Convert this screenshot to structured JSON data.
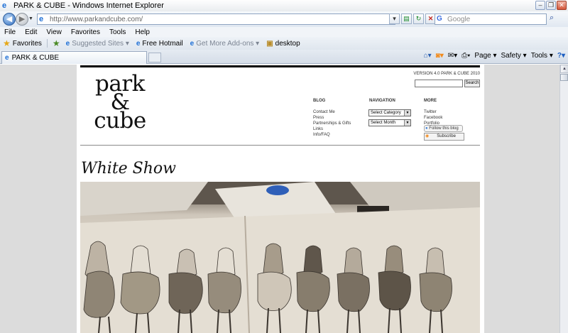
{
  "window": {
    "title": "PARK & CUBE - Windows Internet Explorer"
  },
  "address": {
    "url": "http://www.parkandcube.com/",
    "search_placeholder": "Google"
  },
  "menu": [
    "File",
    "Edit",
    "View",
    "Favorites",
    "Tools",
    "Help"
  ],
  "favorites_bar": {
    "favorites_label": "Favorites",
    "items": [
      {
        "label": "Suggested Sites",
        "muted": true
      },
      {
        "label": "Free Hotmail",
        "muted": false
      },
      {
        "label": "Get More Add-ons",
        "muted": true
      },
      {
        "label": "desktop",
        "muted": false
      }
    ]
  },
  "tab": {
    "label": "PARK & CUBE"
  },
  "command_bar": {
    "page": "Page",
    "safety": "Safety",
    "tools": "Tools"
  },
  "site": {
    "logo_line1": "park",
    "logo_line2": "&",
    "logo_line3": "cube",
    "version": "VERSION 4.0 PARK & CUBE 2010",
    "search_button": "Search",
    "blog_heading": "BLOG",
    "blog_links": [
      "Contact Me",
      "Press",
      "Partnerships & Gifts",
      "Links",
      "Info/FAQ"
    ],
    "nav_heading": "NAVIGATION",
    "category_select": "Select Category",
    "month_select": "Select Month",
    "more_heading": "MORE",
    "more_links": [
      "Twitter",
      "Facebook",
      "Portfolio"
    ],
    "follow_label": "Follow this blog",
    "subscribe_label": "Subscribe",
    "post_title": "White Show"
  },
  "colors": {
    "ie_blue": "#1d6fd6",
    "page_bg": "#dcdcdc"
  }
}
